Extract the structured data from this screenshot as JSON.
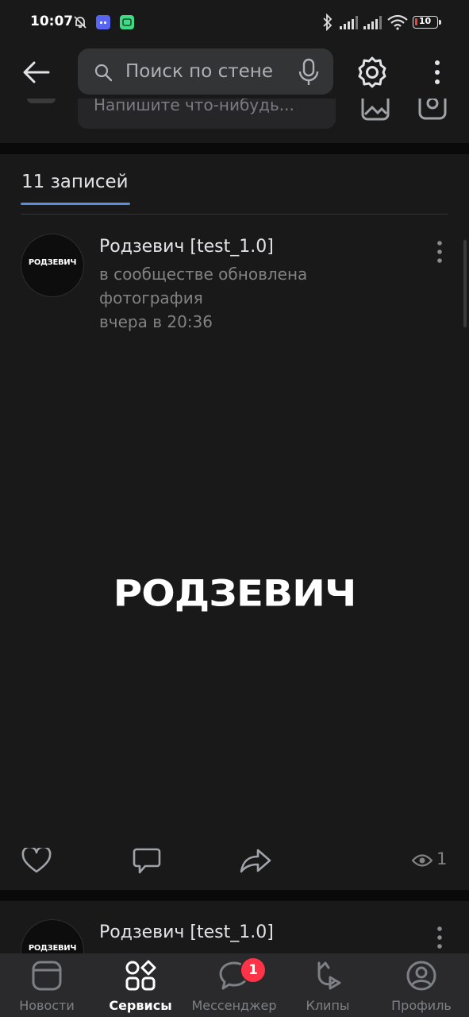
{
  "status_bar": {
    "time": "10:07",
    "battery": "10"
  },
  "top_bar": {
    "search_placeholder": "Поиск по стене",
    "composer_placeholder": "Напишите что-нибудь..."
  },
  "wall": {
    "posts_count_label": "11 записей",
    "posts": [
      {
        "author": "Родзевич [test_1.0]",
        "avatar_text": "РОДЗЕВИЧ",
        "action_line1": "в сообществе обновлена",
        "action_line2": "фотография",
        "time": "вчера в 20:36",
        "image_text": "РОДЗЕВИЧ",
        "views": "1"
      },
      {
        "author": "Родзевич [test_1.0]",
        "avatar_text": "РОДЗЕВИЧ"
      }
    ]
  },
  "bottom_nav": {
    "items": [
      {
        "label": "Новости",
        "icon": "news-icon",
        "active": false
      },
      {
        "label": "Сервисы",
        "icon": "services-icon",
        "active": true
      },
      {
        "label": "Мессенджер",
        "icon": "messenger-icon",
        "active": false,
        "badge": "1"
      },
      {
        "label": "Клипы",
        "icon": "clips-icon",
        "active": false
      },
      {
        "label": "Профиль",
        "icon": "profile-icon",
        "active": false
      }
    ]
  },
  "colors": {
    "background": "#0a0a0a",
    "panel": "#191919",
    "accent": "#5b8ee0",
    "badge": "#ff3347"
  }
}
